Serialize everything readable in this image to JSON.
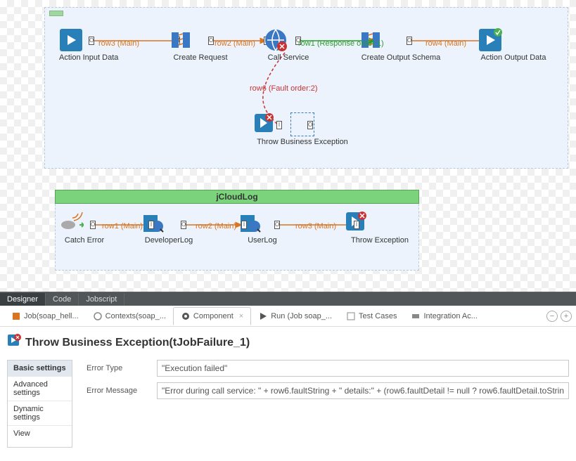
{
  "canvas": {
    "subjob2_title": "jCloudLog",
    "nodes": {
      "action_input": "Action Input Data",
      "create_request": "Create Request",
      "call_service": "Call Service",
      "create_output": "Create Output Schema",
      "action_output": "Action Output Data",
      "throw_biz": "Throw Business Exception",
      "catch_error": "Catch Error",
      "developer_log": "DeveloperLog",
      "user_log": "UserLog",
      "throw_exc": "Throw Exception"
    },
    "connections": {
      "row3": "row3 (Main)",
      "row2": "row2 (Main)",
      "row1_resp": "row1 (Response order:1)",
      "row4": "row4 (Main)",
      "row6": "row6 (Fault order:2)",
      "row1": "row1 (Main)",
      "row2b": "row2 (Main)",
      "row3b": "row3 (Main)"
    }
  },
  "editor_tabs": {
    "designer": "Designer",
    "code": "Code",
    "jobscript": "Jobscript"
  },
  "bottom_tabs": {
    "job": "Job(soap_hell...",
    "contexts": "Contexts(soap_...",
    "component": "Component",
    "run": "Run (Job soap_...",
    "test": "Test Cases",
    "integration": "Integration Ac..."
  },
  "properties": {
    "title": "Throw Business Exception(tJobFailure_1)",
    "nav": {
      "basic": "Basic settings",
      "advanced": "Advanced settings",
      "dynamic": "Dynamic settings",
      "view": "View"
    },
    "fields": {
      "error_type_label": "Error Type",
      "error_type_value": "\"Execution failed\"",
      "error_message_label": "Error Message",
      "error_message_value": "\"Error during call service: \" + row6.faultString + \" details:\" + (row6.faultDetail != null ? row6.faultDetail.toStrin"
    }
  }
}
